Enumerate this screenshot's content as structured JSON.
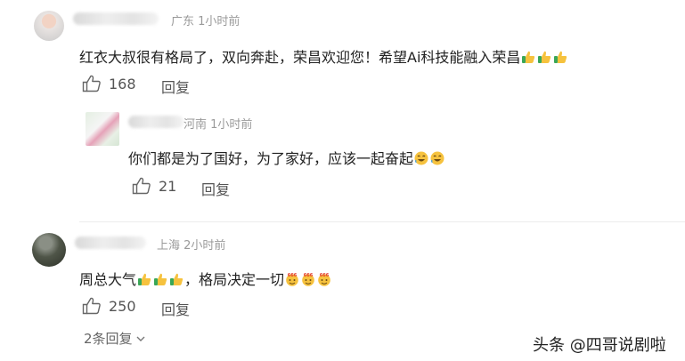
{
  "comments": [
    {
      "location_time": "广东  1小时前",
      "text": "红衣大叔很有格局了，双向奔赴，荣昌欢迎您！希望Ai科技能融入荣昌",
      "emojis": [
        "thumbs-up",
        "thumbs-up",
        "thumbs-up"
      ],
      "likes": "168",
      "reply_label": "回复",
      "reply": {
        "location_time": "河南  1小时前",
        "text": "你们都是为了国好，为了家好，应该一起奋起",
        "emojis": [
          "grin",
          "grin"
        ],
        "likes": "21",
        "reply_label": "回复"
      }
    },
    {
      "location_time": "上海  2小时前",
      "text_before": "周总大气",
      "emojis_mid": [
        "thumbs-up",
        "thumbs-up",
        "thumbs-up"
      ],
      "text_after": "，格局决定一切",
      "emojis_end": [
        "666-face",
        "666-face",
        "666-face"
      ],
      "likes": "250",
      "reply_label": "回复",
      "more_replies": "2条回复"
    }
  ],
  "watermark": "头条 @四哥说剧啦",
  "colors": {
    "text": "#222222",
    "meta": "#9a9a9a",
    "action": "#555555",
    "emoji": "#f6c23e"
  }
}
